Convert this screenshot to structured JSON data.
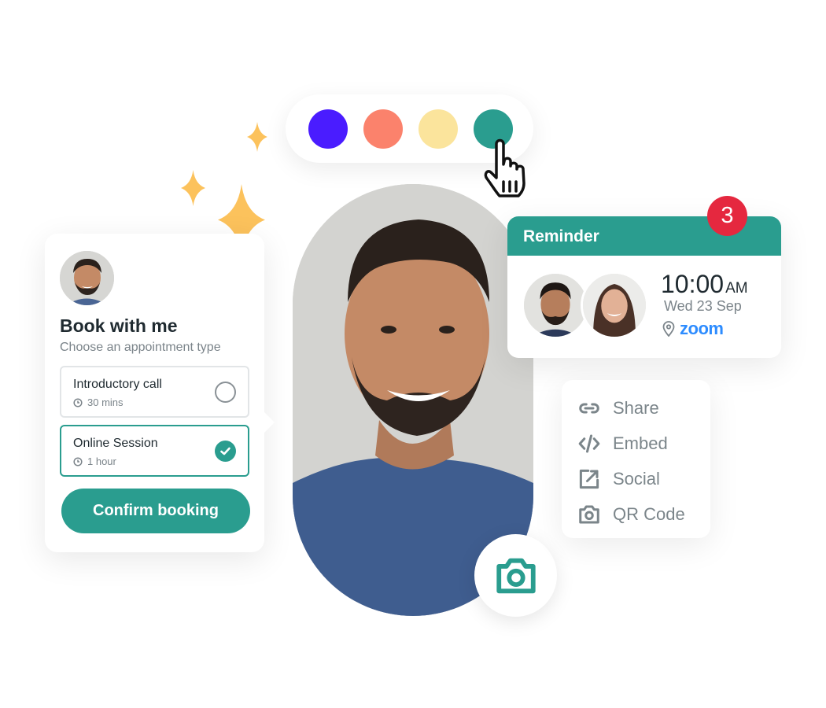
{
  "palette": {
    "swatches": [
      {
        "name": "violet",
        "color": "#4a1cff"
      },
      {
        "name": "coral",
        "color": "#fb826c"
      },
      {
        "name": "butter",
        "color": "#fbe49c"
      },
      {
        "name": "teal",
        "color": "#2a9d8f"
      }
    ]
  },
  "colors": {
    "accent": "#2a9d8f",
    "sparkle": "#fcc25c",
    "badge": "#e5283f",
    "zoom": "#2d8cff",
    "muted_text": "#7b848a"
  },
  "booking": {
    "title": "Book with me",
    "subtitle": "Choose an appointment type",
    "options": [
      {
        "title": "Introductory call",
        "duration": "30 mins",
        "selected": false
      },
      {
        "title": "Online Session",
        "duration": "1 hour",
        "selected": true
      }
    ],
    "confirm_label": "Confirm booking"
  },
  "reminder": {
    "title": "Reminder",
    "badge_count": "3",
    "time": "10:00",
    "ampm": "AM",
    "date": "Wed 23 Sep",
    "location": "zoom"
  },
  "share_menu": {
    "items": [
      {
        "label": "Share",
        "icon": "link-icon"
      },
      {
        "label": "Embed",
        "icon": "code-icon"
      },
      {
        "label": "Social",
        "icon": "external-link-icon"
      },
      {
        "label": "QR Code",
        "icon": "camera-icon"
      }
    ]
  }
}
